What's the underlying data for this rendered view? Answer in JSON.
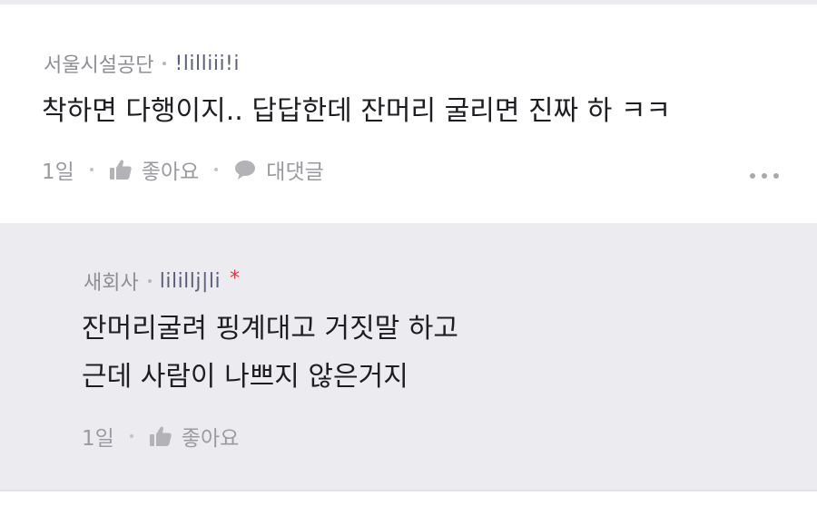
{
  "comment": {
    "author": "서울시설공단",
    "nickname": "!lilliii!i",
    "text": "착하면 다행이지.. 답답한데 잔머리 굴리면 진짜 하 ㅋㅋ",
    "time": "1일",
    "like_label": "좋아요",
    "reply_label": "대댓글",
    "like_icon": "thumbs-up-icon",
    "reply_icon": "speech-bubble-icon",
    "more_icon": "more-options-icon"
  },
  "reply": {
    "author": "새회사",
    "nickname": "lilillj|li",
    "badge": "*",
    "lines": [
      "잔머리굴려 핑계대고 거짓말 하고",
      "근데 사람이 나쁘지 않은거지"
    ],
    "time": "1일",
    "like_label": "좋아요",
    "like_icon": "thumbs-up-icon"
  },
  "colors": {
    "reply_background": "#ececf0",
    "badge": "#e0393e",
    "meta_text": "#9a9aa0",
    "body_text": "#1e1e22"
  }
}
